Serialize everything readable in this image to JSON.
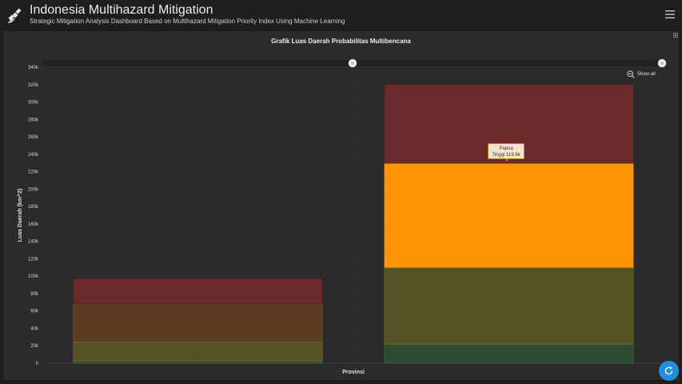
{
  "header": {
    "title": "Indonesia Multihazard Mitigation",
    "subtitle": "Strategic Mitigation Analysis Dashboard Based on Multihazard Mitigation Priority Index Using Machine Learning",
    "logo_icon": "satellite-icon",
    "menu_icon": "hamburger-menu-icon"
  },
  "chart_controls": {
    "show_all_label": "Show all",
    "zoom_icon": "zoom-out-icon",
    "refresh_icon": "refresh-icon"
  },
  "tooltip": {
    "line1": "Papua",
    "line2": "Tinggi:119.6k"
  },
  "colors": {
    "background": "#1e1e1e",
    "panel": "#2b2b2b",
    "sangat_tinggi": "#6b2a2c",
    "tinggi_highlight": "#ff9408",
    "tinggi": "#5c3d24",
    "sedang": "#565226",
    "rendah": "#2f4a33",
    "accent": "#1f8fde"
  },
  "chart_data": {
    "type": "bar",
    "stacked": true,
    "title": "Grafik Luas Daerah Probabilitas Multibencana",
    "xlabel": "Provinsi",
    "ylabel": "Luas Daerah (km^2)",
    "ylim": [
      0,
      340000
    ],
    "yticks": [
      0,
      20000,
      40000,
      60000,
      80000,
      100000,
      120000,
      140000,
      160000,
      180000,
      200000,
      220000,
      240000,
      260000,
      280000,
      300000,
      320000,
      340000
    ],
    "ytick_labels": [
      "0",
      "20k",
      "40k",
      "60k",
      "80k",
      "100k",
      "120k",
      "140k",
      "160k",
      "180k",
      "200k",
      "220k",
      "240k",
      "260k",
      "280k",
      "300k",
      "320k",
      "340k"
    ],
    "categories": [
      "",
      "Papua"
    ],
    "series": [
      {
        "values": [
          2500,
          22000
        ]
      },
      {
        "values": [
          22000,
          88000
        ]
      },
      {
        "values": [
          44000,
          119600
        ]
      },
      {
        "values": [
          28500,
          90400
        ]
      }
    ],
    "highlight": {
      "category_index": 1,
      "series_index": 2
    },
    "grid": true,
    "legend": "none"
  }
}
